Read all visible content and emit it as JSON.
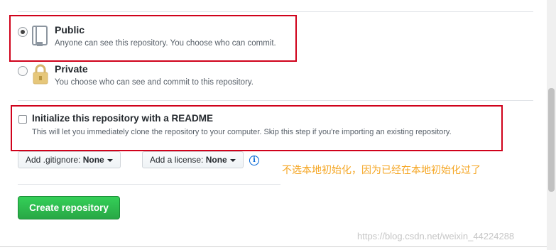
{
  "visibility": {
    "public": {
      "title": "Public",
      "description": "Anyone can see this repository. You choose who can commit.",
      "selected": true
    },
    "private": {
      "title": "Private",
      "description": "You choose who can see and commit to this repository.",
      "selected": false
    }
  },
  "init_readme": {
    "title": "Initialize this repository with a README",
    "description": "This will let you immediately clone the repository to your computer. Skip this step if you're importing an existing repository.",
    "checked": false
  },
  "gitignore": {
    "label": "Add .gitignore:",
    "value": "None"
  },
  "license": {
    "label": "Add a license:",
    "value": "None"
  },
  "annotation": "不选本地初始化，因为已经在本地初始化过了",
  "create_button": "Create repository",
  "watermark": "https://blog.csdn.net/weixin_44224288",
  "colors": {
    "highlight_box": "#d0021b",
    "create_button": "#28a745",
    "annotation": "#f5a623"
  },
  "icons": [
    "repo-icon",
    "lock-icon",
    "info-icon",
    "caret-down-icon"
  ]
}
